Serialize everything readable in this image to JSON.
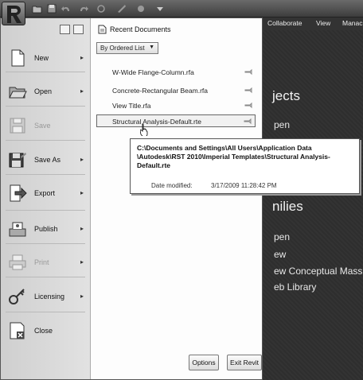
{
  "ribbon_tabs": [
    "Collaborate",
    "View",
    "Manac"
  ],
  "background": {
    "projects_heading": "jects",
    "projects_links": [
      "pen"
    ],
    "families_heading": "nilies",
    "families_links": [
      "pen",
      "ew",
      "ew Conceptual Mass",
      "eb Library"
    ]
  },
  "menu": {
    "items": [
      {
        "label": "New",
        "icon": "new-doc-icon",
        "submenu": true,
        "enabled": true
      },
      {
        "label": "Open",
        "icon": "open-folder-icon",
        "submenu": true,
        "enabled": true
      },
      {
        "label": "Save",
        "icon": "save-disk-icon",
        "submenu": false,
        "enabled": false
      },
      {
        "label": "Save As",
        "icon": "save-as-icon",
        "submenu": true,
        "enabled": true
      },
      {
        "label": "Export",
        "icon": "export-icon",
        "submenu": true,
        "enabled": true
      },
      {
        "label": "Publish",
        "icon": "publish-icon",
        "submenu": true,
        "enabled": true
      },
      {
        "label": "Print",
        "icon": "print-icon",
        "submenu": true,
        "enabled": false
      },
      {
        "label": "Licensing",
        "icon": "key-icon",
        "submenu": true,
        "enabled": true
      },
      {
        "label": "Close",
        "icon": "close-doc-icon",
        "submenu": false,
        "enabled": true
      }
    ],
    "arrow_glyph": "▸"
  },
  "recent": {
    "title": "Recent Documents",
    "order_label": "By Ordered List",
    "documents": [
      "W-Wide Flange-Column.rfa",
      "Concrete-Rectangular Beam.rfa",
      "View Title.rfa",
      "Structural Analysis-Default.rte"
    ]
  },
  "tooltip": {
    "path_lines": [
      "C:\\Documents and Settings\\All Users\\Application Data",
      "\\Autodesk\\RST 2010\\Imperial Templates\\Structural Analysis-",
      "Default.rte"
    ],
    "date_label": "Date modified:",
    "date_value": "3/17/2009 11:28:42 PM"
  },
  "buttons": {
    "options": "Options",
    "exit": "Exit Revit"
  }
}
